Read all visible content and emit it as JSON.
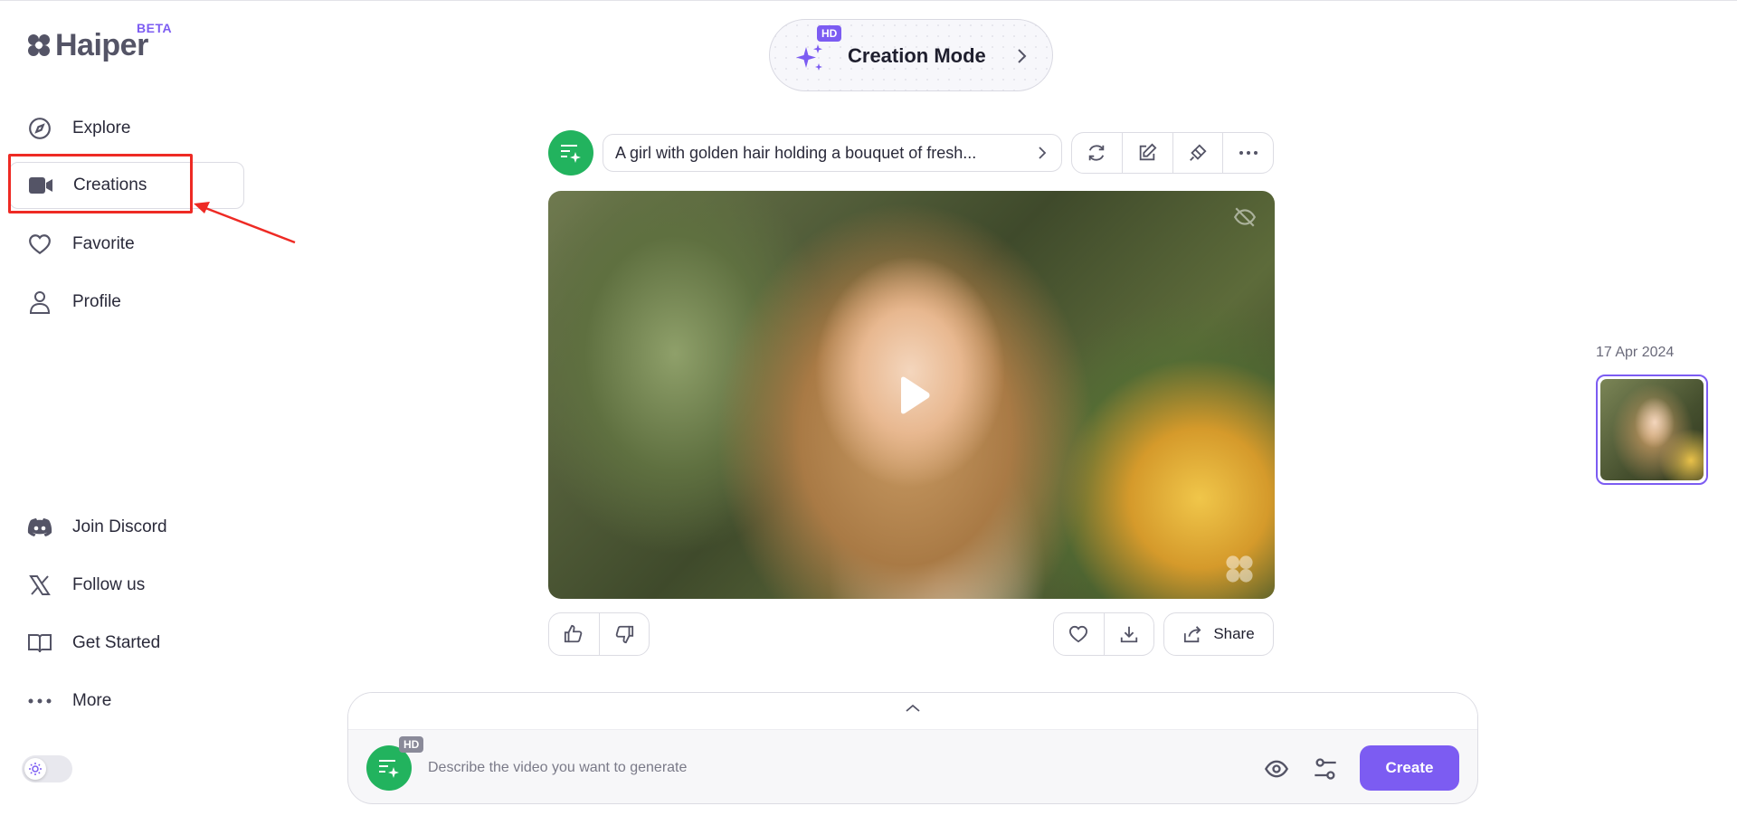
{
  "brand": {
    "name": "Haiper",
    "badge": "BETA"
  },
  "nav": {
    "top": [
      {
        "label": "Explore",
        "icon": "compass-icon"
      },
      {
        "label": "Creations",
        "icon": "video-camera-icon",
        "active": true
      },
      {
        "label": "Favorite",
        "icon": "heart-icon"
      },
      {
        "label": "Profile",
        "icon": "user-icon"
      }
    ],
    "bottom": [
      {
        "label": "Join Discord",
        "icon": "discord-icon"
      },
      {
        "label": "Follow us",
        "icon": "x-logo-icon"
      },
      {
        "label": "Get Started",
        "icon": "book-icon"
      },
      {
        "label": "More",
        "icon": "more-dots-icon"
      }
    ]
  },
  "mode": {
    "title": "Creation Mode",
    "badge": "HD"
  },
  "creation": {
    "prompt": "A girl with golden hair holding a bouquet of fresh...",
    "share_label": "Share"
  },
  "timeline": {
    "date": "17 Apr 2024"
  },
  "composer": {
    "placeholder": "Describe the video you want to generate",
    "badge": "HD",
    "create_label": "Create"
  },
  "colors": {
    "accent": "#7c5cf2",
    "green": "#22b35e",
    "highlight": "#ee2a24"
  }
}
